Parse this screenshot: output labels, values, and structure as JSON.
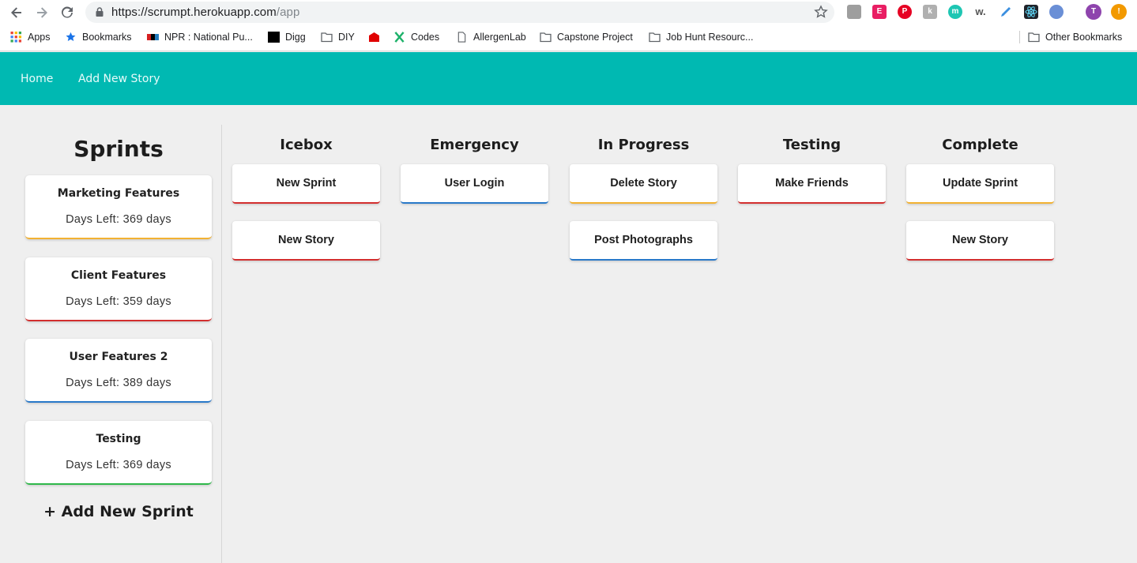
{
  "browser": {
    "url_host": "https://scrumpt.herokuapp.com",
    "url_path": "/app",
    "bookmarks": [
      {
        "label": "Apps",
        "icon": "apps-grid-icon"
      },
      {
        "label": "Bookmarks",
        "icon": "star-icon"
      },
      {
        "label": "NPR : National Pu...",
        "icon": "npr-icon"
      },
      {
        "label": "Digg",
        "icon": "digg-icon"
      },
      {
        "label": "DIY",
        "icon": "folder-icon"
      },
      {
        "label": "",
        "icon": "red-house-icon"
      },
      {
        "label": "Codes",
        "icon": "x-logo-icon"
      },
      {
        "label": "AllergenLab",
        "icon": "page-icon"
      },
      {
        "label": "Capstone Project",
        "icon": "folder-icon"
      },
      {
        "label": "Job Hunt Resourc...",
        "icon": "folder-icon"
      }
    ],
    "other_bookmarks": "Other Bookmarks",
    "profile_initial": "T",
    "extensions": [
      "calendar-icon",
      "e-extension-icon",
      "pinterest-icon",
      "k-extension-icon",
      "m-extension-icon",
      "w-extension-icon",
      "highlighter-icon",
      "react-icon",
      "feather-icon"
    ]
  },
  "nav": {
    "home": "Home",
    "add_story": "Add New Story"
  },
  "sidebar": {
    "title": "Sprints",
    "sprints": [
      {
        "name": "Marketing Features",
        "days": "Days Left: 369 days",
        "accent": "#f2b233"
      },
      {
        "name": "Client Features",
        "days": "Days Left: 359 days",
        "accent": "#d32f2f"
      },
      {
        "name": "User Features 2",
        "days": "Days Left: 389 days",
        "accent": "#2979c9"
      },
      {
        "name": "Testing",
        "days": "Days Left: 369 days",
        "accent": "#2fb84a"
      }
    ],
    "add_sprint": "+ Add New Sprint"
  },
  "board": {
    "columns": [
      {
        "title": "Icebox",
        "stories": [
          {
            "label": "New Sprint",
            "accent": "#d32f2f"
          },
          {
            "label": "New Story",
            "accent": "#d32f2f"
          }
        ]
      },
      {
        "title": "Emergency",
        "stories": [
          {
            "label": "User Login",
            "accent": "#2979c9"
          }
        ]
      },
      {
        "title": "In Progress",
        "stories": [
          {
            "label": "Delete Story",
            "accent": "#f2b233"
          },
          {
            "label": "Post Photographs",
            "accent": "#2979c9"
          }
        ]
      },
      {
        "title": "Testing",
        "stories": [
          {
            "label": "Make Friends",
            "accent": "#d32f2f"
          }
        ]
      },
      {
        "title": "Complete",
        "stories": [
          {
            "label": "Update Sprint",
            "accent": "#f2b233"
          },
          {
            "label": "New Story",
            "accent": "#d32f2f"
          }
        ]
      }
    ]
  },
  "colors": {
    "nav_bg": "#00b9b2",
    "page_bg": "#efefef"
  }
}
